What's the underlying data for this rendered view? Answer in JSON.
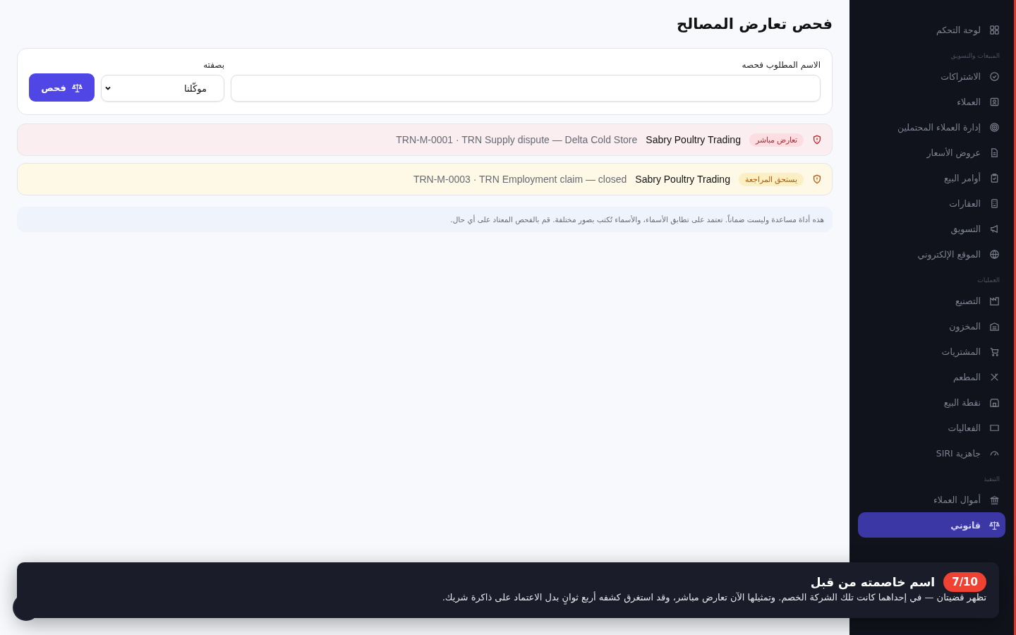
{
  "page": {
    "title": "فحص تعارض المصالح"
  },
  "form": {
    "name_label": "الاسم المطلوب فحصه",
    "role_label": "بصفته",
    "role_value": "موكّلنا",
    "submit": "فحص"
  },
  "results": [
    {
      "kind": "direct",
      "badge": "تعارض مباشر",
      "party": "Sabry Poultry Trading",
      "matter": "TRN-M-0001 · TRN Supply dispute — Delta Cold Store"
    },
    {
      "kind": "review",
      "badge": "يستحق المراجعة",
      "party": "Sabry Poultry Trading",
      "matter": "TRN-M-0003 · TRN Employment claim — closed"
    }
  ],
  "disclaimer": "هذه أداة مساعدة وليست ضماناً. تعتمد على تطابق الأسماء، والأسماء تُكتب بصور مختلفة. قم بالفحص المعتاد على أي حال.",
  "sidebar": {
    "items": [
      {
        "kind": "item",
        "label": "لوحة التحكم",
        "selected": false
      },
      {
        "kind": "section",
        "label": "المبيعات والتسويق"
      },
      {
        "kind": "item",
        "label": "الاشتراكات",
        "selected": false
      },
      {
        "kind": "item",
        "label": "العملاء",
        "selected": false
      },
      {
        "kind": "item",
        "label": "إدارة العملاء المحتملين",
        "selected": false
      },
      {
        "kind": "item",
        "label": "عروض الأسعار",
        "selected": false
      },
      {
        "kind": "item",
        "label": "أوامر البيع",
        "selected": false
      },
      {
        "kind": "item",
        "label": "العقارات",
        "selected": false
      },
      {
        "kind": "item",
        "label": "التسويق",
        "selected": false
      },
      {
        "kind": "item",
        "label": "الموقع الإلكتروني",
        "selected": false
      },
      {
        "kind": "section",
        "label": "العمليات"
      },
      {
        "kind": "item",
        "label": "التصنيع",
        "selected": false
      },
      {
        "kind": "item",
        "label": "المخزون",
        "selected": false
      },
      {
        "kind": "item",
        "label": "المشتريات",
        "selected": false
      },
      {
        "kind": "item",
        "label": "المطعم",
        "selected": false
      },
      {
        "kind": "item",
        "label": "نقطة البيع",
        "selected": false
      },
      {
        "kind": "item",
        "label": "الفعاليات",
        "selected": false
      },
      {
        "kind": "item",
        "label": "جاهزية SIRI",
        "selected": false
      },
      {
        "kind": "section",
        "label": "التنفيذ"
      },
      {
        "kind": "item",
        "label": "أموال العملاء",
        "selected": false
      },
      {
        "kind": "item",
        "label": "قانوني",
        "selected": true
      }
    ]
  },
  "tour": {
    "step": "7/10",
    "title": "اسم خاصمته من قبل",
    "text": "تظهر قضيتان — في إحداهما كانت تلك الشركة الخصم. وتمثيلها الآن تعارض مباشر، وقد استغرق كشفه أربع ثوانٍ بدل الاعتماد على ذاكرة شريك."
  }
}
